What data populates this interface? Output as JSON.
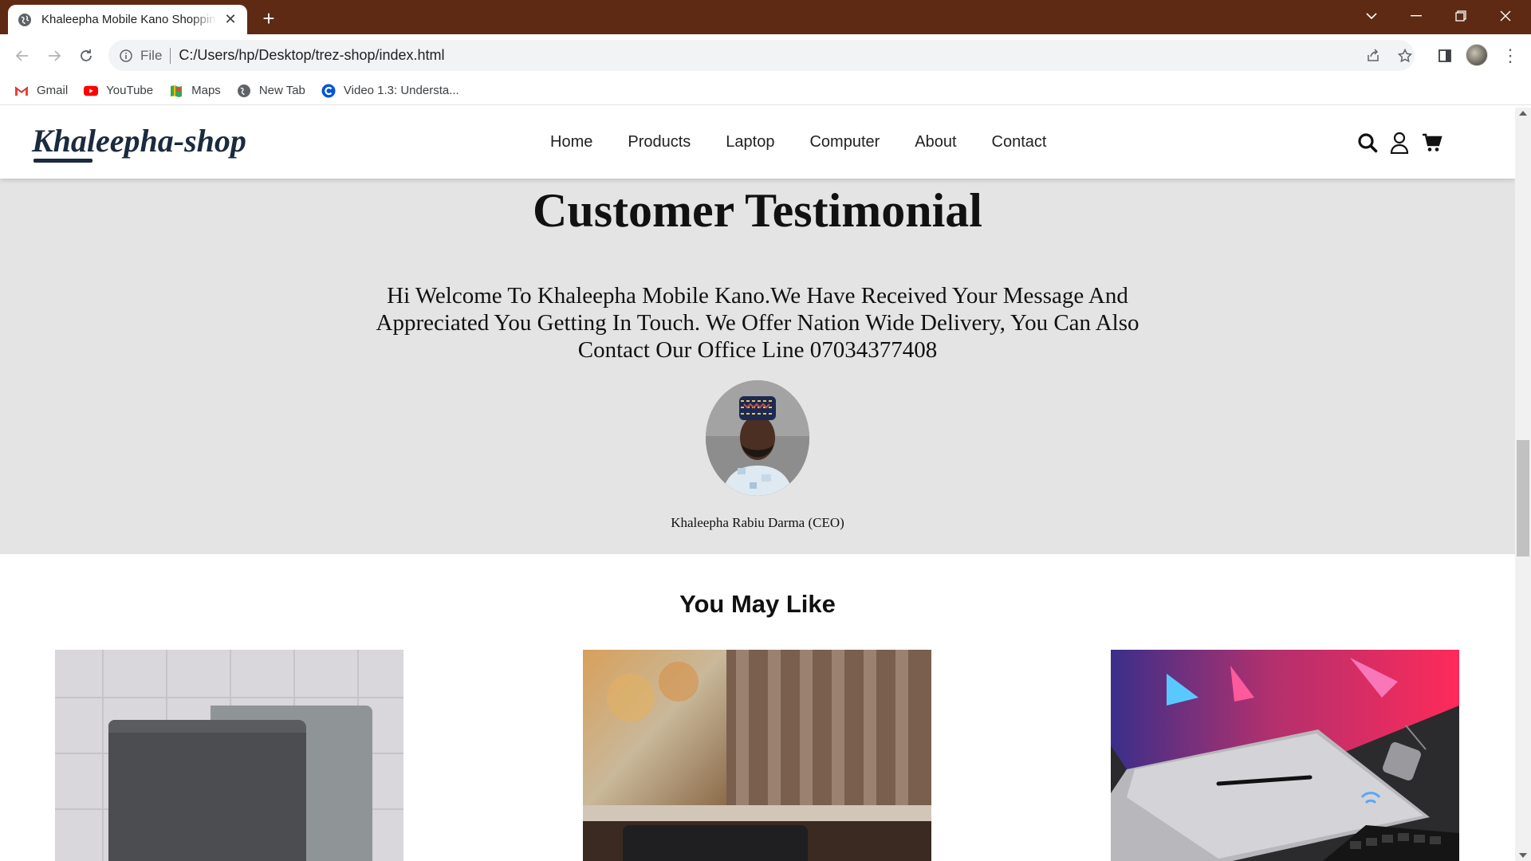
{
  "browser": {
    "tab_title": "Khaleepha Mobile Kano Shopping",
    "url_scheme": "File",
    "url": "C:/Users/hp/Desktop/trez-shop/index.html",
    "bookmarks": [
      {
        "label": "Gmail",
        "icon": "gmail-icon"
      },
      {
        "label": "YouTube",
        "icon": "youtube-icon"
      },
      {
        "label": "Maps",
        "icon": "maps-icon"
      },
      {
        "label": "New Tab",
        "icon": "globe-icon"
      },
      {
        "label": "Video 1.3: Understa...",
        "icon": "coursera-icon"
      }
    ],
    "frame_color": "#5e2a14"
  },
  "site": {
    "logo": "Khaleepha-shop",
    "nav": [
      "Home",
      "Products",
      "Laptop",
      "Computer",
      "About",
      "Contact"
    ],
    "icons": [
      "search-icon",
      "user-icon",
      "cart-icon"
    ]
  },
  "testimonial": {
    "title": "Customer Testimonial",
    "text": "Hi Welcome To Khaleepha Mobile Kano.We Have Received Your Message And Appreciated You Getting In Touch. We Offer Nation Wide Delivery, You Can Also Contact Our Office Line 07034377408",
    "name": "Khaleepha Rabiu Darma (CEO)",
    "background": "#e4e4e4"
  },
  "may_like": {
    "title": "You May Like"
  }
}
